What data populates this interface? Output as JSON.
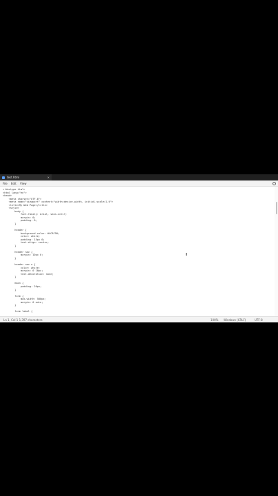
{
  "window": {
    "tab_title": "test.html",
    "tab_close": "×"
  },
  "menu": {
    "file": "File",
    "edit": "Edit",
    "view": "View"
  },
  "editor": {
    "code": "<!doctype html>\n<html lang=\"en\">\n<head>\n    <meta charset=\"UTF-8\">\n    <meta name=\"viewport\" content=\"width=device-width, initial-scale=1.0\">\n    <title>My Web Page</title>\n    <style>\n        body {\n            font-family: Arial, sans-serif;\n            margin: 0;\n            padding: 0;\n        }\n\n        header {\n            background-color: #4CAF50;\n            color: white;\n            padding: 15px 0;\n            text-align: center;\n        }\n\n        header nav {\n            margin: 10px 0;\n        }\n\n        header nav a {\n            color: white;\n            margin: 0 10px;\n            text-decoration: none;\n        }\n\n        main {\n            padding: 20px;\n        }\n\n        form {\n            max-width: 500px;\n            margin: 0 auto;\n        }\n\n        form label {"
  },
  "status": {
    "position": "Ln 1, Col 1  1,397 characters",
    "zoom": "100%",
    "eol": "Windows (CRLF)",
    "encoding": "UTF-8"
  },
  "icons": {
    "app": "notepad-icon",
    "settings": "gear-icon"
  },
  "colors": {
    "background": "#000000",
    "titlebar": "#202020",
    "menubar": "#f3f3f3",
    "editor": "#ffffff"
  }
}
